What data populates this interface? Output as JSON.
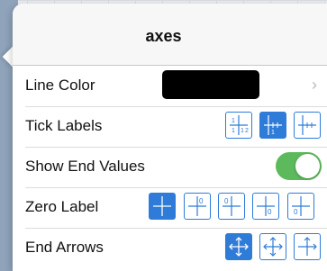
{
  "title": "axes",
  "rows": [
    {
      "label": "Line Color",
      "value_color": "#000000"
    },
    {
      "label": "Tick Labels",
      "options": [
        "tick-labels-both-icon",
        "tick-labels-single-icon",
        "tick-labels-none-icon"
      ],
      "selected_index": 1
    },
    {
      "label": "Show End Values",
      "toggle": true
    },
    {
      "label": "Zero Label",
      "options": [
        "zero-label-none-icon",
        "zero-label-top-icon",
        "zero-label-top-left-icon",
        "zero-label-bottom-icon",
        "zero-label-bottom-left-icon"
      ],
      "selected_index": 0,
      "glyph": "0"
    },
    {
      "label": "End Arrows",
      "options": [
        "arrows-all-icon",
        "arrows-positive-icon",
        "arrows-none-icon"
      ],
      "selected_index": 0
    }
  ],
  "tick_glyphs": {
    "a": "1",
    "b": "2"
  },
  "colors": {
    "accent": "#2f7bd8",
    "toggle_on": "#5cba5c"
  }
}
